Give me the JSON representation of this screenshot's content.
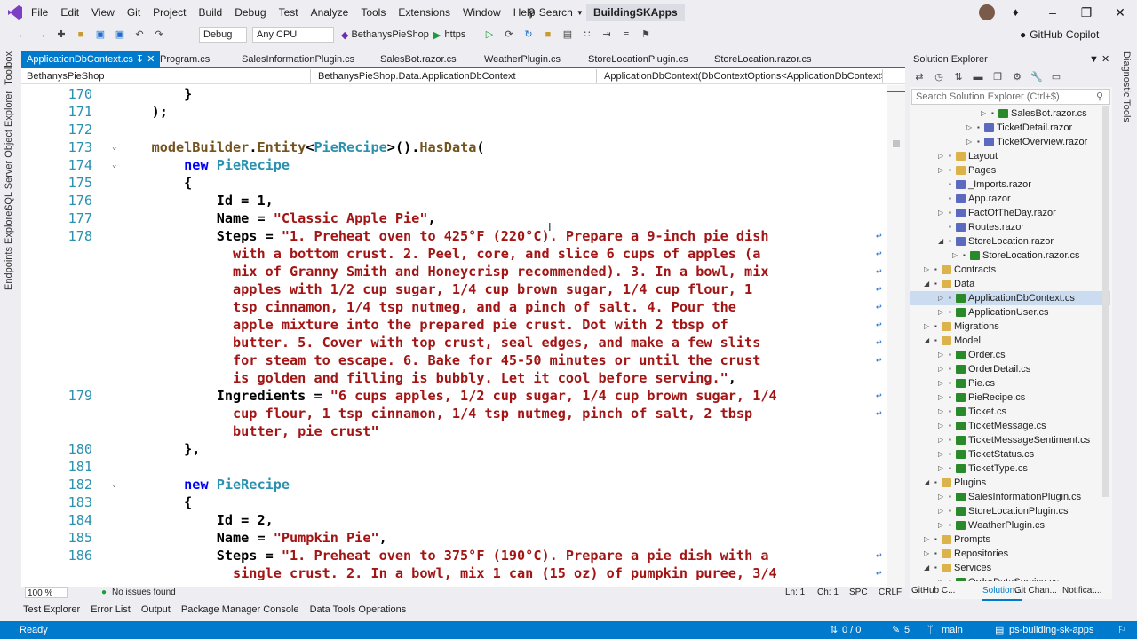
{
  "menubar": {
    "items": [
      "File",
      "Edit",
      "View",
      "Git",
      "Project",
      "Build",
      "Debug",
      "Test",
      "Analyze",
      "Tools",
      "Extensions",
      "Window",
      "Help"
    ],
    "search": "Search",
    "solution": "BuildingSKApps"
  },
  "toolbar": {
    "config": "Debug",
    "platform": "Any CPU",
    "startup": "BethanysPieShop",
    "launch": "https",
    "copilot": "GitHub Copilot"
  },
  "left_tools": [
    "Toolbox",
    "SQL Server Object Explorer",
    "Endpoints Explorer"
  ],
  "right_tools": [
    "Diagnostic Tools"
  ],
  "tabs": [
    "ApplicationDbContext.cs",
    "Program.cs",
    "SalesInformationPlugin.cs",
    "SalesBot.razor.cs",
    "WeatherPlugin.cs",
    "StoreLocationPlugin.cs",
    "StoreLocation.razor.cs"
  ],
  "navbar": {
    "project": "BethanysPieShop",
    "type": "BethanysPieShop.Data.ApplicationDbContext",
    "member": "ApplicationDbContext(DbContextOptions<ApplicationDbContext>"
  },
  "code": [
    {
      "n": "170",
      "t": [
        [
          "pl",
          "        }"
        ]
      ]
    },
    {
      "n": "171",
      "t": [
        [
          "pl",
          "    );"
        ]
      ]
    },
    {
      "n": "172",
      "t": []
    },
    {
      "n": "173",
      "fold": 1,
      "t": [
        [
          "pl",
          "    "
        ],
        [
          "me",
          "modelBuilder"
        ],
        [
          "pl",
          "."
        ],
        [
          "me",
          "Entity"
        ],
        [
          "pl",
          "<"
        ],
        [
          "ty",
          "PieRecipe"
        ],
        [
          "pl",
          ">()."
        ],
        [
          "me",
          "HasData"
        ],
        [
          "pl",
          "("
        ]
      ]
    },
    {
      "n": "174",
      "fold": 1,
      "t": [
        [
          "pl",
          "        "
        ],
        [
          "kw",
          "new "
        ],
        [
          "ty",
          "PieRecipe"
        ]
      ]
    },
    {
      "n": "175",
      "t": [
        [
          "pl",
          "        {"
        ]
      ]
    },
    {
      "n": "176",
      "t": [
        [
          "pl",
          "            Id = 1,"
        ]
      ]
    },
    {
      "n": "177",
      "t": [
        [
          "pl",
          "            Name = "
        ],
        [
          "st",
          "\"Classic Apple Pie\""
        ],
        [
          "pl",
          ","
        ]
      ]
    },
    {
      "n": "178",
      "w": 1,
      "t": [
        [
          "pl",
          "            Steps = "
        ],
        [
          "st",
          "\"1. Preheat oven to 425°F (220°C). Prepare a 9-inch pie dish"
        ]
      ]
    },
    {
      "n": "",
      "w": 1,
      "t": [
        [
          "st",
          "              with a bottom crust. 2. Peel, core, and slice 6 cups of apples (a"
        ]
      ]
    },
    {
      "n": "",
      "w": 1,
      "t": [
        [
          "st",
          "              mix of Granny Smith and Honeycrisp recommended). 3. In a bowl, mix"
        ]
      ]
    },
    {
      "n": "",
      "w": 1,
      "t": [
        [
          "st",
          "              apples with 1/2 cup sugar, 1/4 cup brown sugar, 1/4 cup flour, 1"
        ]
      ]
    },
    {
      "n": "",
      "w": 1,
      "t": [
        [
          "st",
          "              tsp cinnamon, 1/4 tsp nutmeg, and a pinch of salt. 4. Pour the"
        ]
      ]
    },
    {
      "n": "",
      "w": 1,
      "t": [
        [
          "st",
          "              apple mixture into the prepared pie crust. Dot with 2 tbsp of"
        ]
      ]
    },
    {
      "n": "",
      "w": 1,
      "t": [
        [
          "st",
          "              butter. 5. Cover with top crust, seal edges, and make a few slits"
        ]
      ]
    },
    {
      "n": "",
      "w": 1,
      "t": [
        [
          "st",
          "              for steam to escape. 6. Bake for 45-50 minutes or until the crust"
        ]
      ]
    },
    {
      "n": "",
      "t": [
        [
          "st",
          "              is golden and filling is bubbly. Let it cool before serving.\""
        ],
        [
          "pl",
          ","
        ]
      ]
    },
    {
      "n": "179",
      "w": 1,
      "t": [
        [
          "pl",
          "            Ingredients = "
        ],
        [
          "st",
          "\"6 cups apples, 1/2 cup sugar, 1/4 cup brown sugar, 1/4"
        ]
      ]
    },
    {
      "n": "",
      "w": 1,
      "t": [
        [
          "st",
          "              cup flour, 1 tsp cinnamon, 1/4 tsp nutmeg, pinch of salt, 2 tbsp"
        ]
      ]
    },
    {
      "n": "",
      "t": [
        [
          "st",
          "              butter, pie crust\""
        ]
      ]
    },
    {
      "n": "180",
      "t": [
        [
          "pl",
          "        },"
        ]
      ]
    },
    {
      "n": "181",
      "t": []
    },
    {
      "n": "182",
      "fold": 1,
      "t": [
        [
          "pl",
          "        "
        ],
        [
          "kw",
          "new "
        ],
        [
          "ty",
          "PieRecipe"
        ]
      ]
    },
    {
      "n": "183",
      "t": [
        [
          "pl",
          "        {"
        ]
      ]
    },
    {
      "n": "184",
      "t": [
        [
          "pl",
          "            Id = 2,"
        ]
      ]
    },
    {
      "n": "185",
      "t": [
        [
          "pl",
          "            Name = "
        ],
        [
          "st",
          "\"Pumpkin Pie\""
        ],
        [
          "pl",
          ","
        ]
      ]
    },
    {
      "n": "186",
      "w": 1,
      "t": [
        [
          "pl",
          "            Steps = "
        ],
        [
          "st",
          "\"1. Preheat oven to 375°F (190°C). Prepare a pie dish with a"
        ]
      ]
    },
    {
      "n": "",
      "w": 1,
      "t": [
        [
          "st",
          "              single crust. 2. In a bowl, mix 1 can (15 oz) of pumpkin puree, 3/4"
        ]
      ]
    }
  ],
  "editor_status": {
    "zoom": "100 %",
    "issues": "No issues found",
    "ln": "Ln: 1",
    "ch": "Ch: 1",
    "spc": "SPC",
    "crlf": "CRLF"
  },
  "solution_explorer": {
    "title": "Solution Explorer",
    "search_placeholder": "Search Solution Explorer (Ctrl+$)",
    "items": [
      {
        "l": "SalesBot.razor.cs",
        "d": 4,
        "k": "cs",
        "a": "r"
      },
      {
        "l": "TicketDetail.razor",
        "d": 3,
        "k": "razor",
        "a": "r"
      },
      {
        "l": "TicketOverview.razor",
        "d": 3,
        "k": "razor",
        "a": "r"
      },
      {
        "l": "Layout",
        "d": 1,
        "k": "folder",
        "a": "r"
      },
      {
        "l": "Pages",
        "d": 1,
        "k": "folder",
        "a": "r"
      },
      {
        "l": "_Imports.razor",
        "d": 1,
        "k": "razor",
        "a": ""
      },
      {
        "l": "App.razor",
        "d": 1,
        "k": "razor",
        "a": ""
      },
      {
        "l": "FactOfTheDay.razor",
        "d": 1,
        "k": "razor",
        "a": "r"
      },
      {
        "l": "Routes.razor",
        "d": 1,
        "k": "razor",
        "a": ""
      },
      {
        "l": "StoreLocation.razor",
        "d": 1,
        "k": "razor",
        "a": "d"
      },
      {
        "l": "StoreLocation.razor.cs",
        "d": 2,
        "k": "cs",
        "a": "r"
      },
      {
        "l": "Contracts",
        "d": 0,
        "k": "folder",
        "a": "r"
      },
      {
        "l": "Data",
        "d": 0,
        "k": "folder",
        "a": "d"
      },
      {
        "l": "ApplicationDbContext.cs",
        "d": 1,
        "k": "cs",
        "a": "r",
        "sel": 1
      },
      {
        "l": "ApplicationUser.cs",
        "d": 1,
        "k": "cs",
        "a": "r"
      },
      {
        "l": "Migrations",
        "d": 0,
        "k": "folder",
        "a": "r"
      },
      {
        "l": "Model",
        "d": 0,
        "k": "folder",
        "a": "d"
      },
      {
        "l": "Order.cs",
        "d": 1,
        "k": "cs",
        "a": "r"
      },
      {
        "l": "OrderDetail.cs",
        "d": 1,
        "k": "cs",
        "a": "r"
      },
      {
        "l": "Pie.cs",
        "d": 1,
        "k": "cs",
        "a": "r"
      },
      {
        "l": "PieRecipe.cs",
        "d": 1,
        "k": "cs",
        "a": "r"
      },
      {
        "l": "Ticket.cs",
        "d": 1,
        "k": "cs",
        "a": "r"
      },
      {
        "l": "TicketMessage.cs",
        "d": 1,
        "k": "cs",
        "a": "r"
      },
      {
        "l": "TicketMessageSentiment.cs",
        "d": 1,
        "k": "cs",
        "a": "r"
      },
      {
        "l": "TicketStatus.cs",
        "d": 1,
        "k": "cs",
        "a": "r"
      },
      {
        "l": "TicketType.cs",
        "d": 1,
        "k": "cs",
        "a": "r"
      },
      {
        "l": "Plugins",
        "d": 0,
        "k": "folder",
        "a": "d"
      },
      {
        "l": "SalesInformationPlugin.cs",
        "d": 1,
        "k": "cs",
        "a": "r"
      },
      {
        "l": "StoreLocationPlugin.cs",
        "d": 1,
        "k": "cs",
        "a": "r"
      },
      {
        "l": "WeatherPlugin.cs",
        "d": 1,
        "k": "cs",
        "a": "r"
      },
      {
        "l": "Prompts",
        "d": 0,
        "k": "folder",
        "a": "r"
      },
      {
        "l": "Repositories",
        "d": 0,
        "k": "folder",
        "a": "r"
      },
      {
        "l": "Services",
        "d": 0,
        "k": "folder",
        "a": "d"
      },
      {
        "l": "OrderDataService.cs",
        "d": 1,
        "k": "cs",
        "a": "r"
      }
    ],
    "bottom_tabs": [
      "GitHub C...",
      "Solution...",
      "Git Chan...",
      "Notificat..."
    ]
  },
  "bottom_tabs": [
    "Test Explorer",
    "Error List",
    "Output",
    "Package Manager Console",
    "Data Tools Operations"
  ],
  "statusbar": {
    "ready": "Ready",
    "sync": "0 / 0",
    "edits": "5",
    "branch": "main",
    "repo": "ps-building-sk-apps"
  },
  "colors": {
    "accent": "#007acc",
    "keyword": "#0000ff",
    "type": "#2b91af",
    "string": "#a31515",
    "method": "#74531f"
  }
}
